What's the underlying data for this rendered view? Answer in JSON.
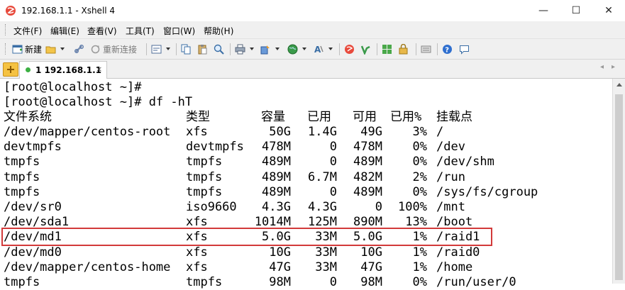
{
  "window": {
    "title": "192.168.1.1 - Xshell 4",
    "minimize": "—",
    "maximize": "☐",
    "close": "✕"
  },
  "menu": [
    "文件(F)",
    "编辑(E)",
    "查看(V)",
    "工具(T)",
    "窗口(W)",
    "帮助(H)"
  ],
  "toolbar": {
    "new_label": "新建",
    "reconnect_label": "重新连接"
  },
  "tab": {
    "label": "1 192.168.1.1",
    "close": "×",
    "prev": "◂",
    "next": "▸"
  },
  "terminal": {
    "prompt1": "[root@localhost ~]#",
    "prompt2": "[root@localhost ~]# df -hT",
    "headers": [
      "文件系统",
      "类型",
      "容量",
      "已用",
      "可用",
      "已用%",
      "挂载点"
    ],
    "rows": [
      [
        "/dev/mapper/centos-root",
        "xfs",
        "50G",
        "1.4G",
        "49G",
        "3%",
        "/"
      ],
      [
        "devtmpfs",
        "devtmpfs",
        "478M",
        "0",
        "478M",
        "0%",
        "/dev"
      ],
      [
        "tmpfs",
        "tmpfs",
        "489M",
        "0",
        "489M",
        "0%",
        "/dev/shm"
      ],
      [
        "tmpfs",
        "tmpfs",
        "489M",
        "6.7M",
        "482M",
        "2%",
        "/run"
      ],
      [
        "tmpfs",
        "tmpfs",
        "489M",
        "0",
        "489M",
        "0%",
        "/sys/fs/cgroup"
      ],
      [
        "/dev/sr0",
        "iso9660",
        "4.3G",
        "4.3G",
        "0",
        "100%",
        "/mnt"
      ],
      [
        "/dev/sda1",
        "xfs",
        "1014M",
        "125M",
        "890M",
        "13%",
        "/boot"
      ],
      [
        "/dev/md1",
        "xfs",
        "5.0G",
        "33M",
        "5.0G",
        "1%",
        "/raid1"
      ],
      [
        "/dev/md0",
        "xfs",
        "10G",
        "33M",
        "10G",
        "1%",
        "/raid0"
      ],
      [
        "/dev/mapper/centos-home",
        "xfs",
        "47G",
        "33M",
        "47G",
        "1%",
        "/home"
      ],
      [
        "tmpfs",
        "tmpfs",
        "98M",
        "0",
        "98M",
        "0%",
        "/run/user/0"
      ]
    ],
    "highlighted_row": 7
  },
  "colors": {
    "highlight_border": "#d23a3a",
    "tab_status": "#3cb043"
  }
}
